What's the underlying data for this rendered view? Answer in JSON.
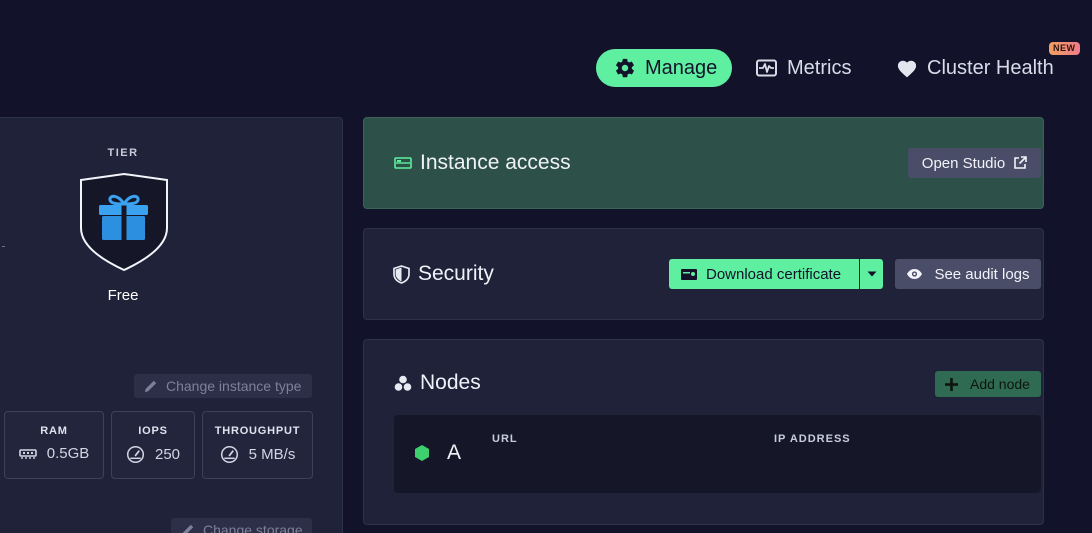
{
  "nav": {
    "manage_label": "Manage",
    "metrics_label": "Metrics",
    "health_label": "Cluster Health",
    "new_badge": "NEW"
  },
  "tier": {
    "heading": "TIER",
    "name": "Free",
    "change_type_label": "Change instance type",
    "change_storage_label": "Change storage"
  },
  "stats": [
    {
      "title": "RAM",
      "value": "0.5GB",
      "icon": "memory-icon"
    },
    {
      "title": "IOPS",
      "value": "250",
      "icon": "gauge-icon"
    },
    {
      "title": "THROUGHPUT",
      "value": "5 MB/s",
      "icon": "gauge-icon"
    }
  ],
  "access": {
    "title": "Instance access",
    "open_studio_label": "Open Studio"
  },
  "security": {
    "title": "Security",
    "download_label": "Download certificate",
    "audit_label": "See audit logs"
  },
  "nodes": {
    "title": "Nodes",
    "add_label": "Add node",
    "columns": [
      "URL",
      "IP ADDRESS"
    ],
    "rows": [
      {
        "name": "A",
        "url": "",
        "ip": ""
      }
    ]
  },
  "colors": {
    "background": "#12132a",
    "panel": "#1f2239",
    "accent_green": "#5ef0a0",
    "access_card": "#2d5148",
    "node_status": "#3ecf6e"
  }
}
